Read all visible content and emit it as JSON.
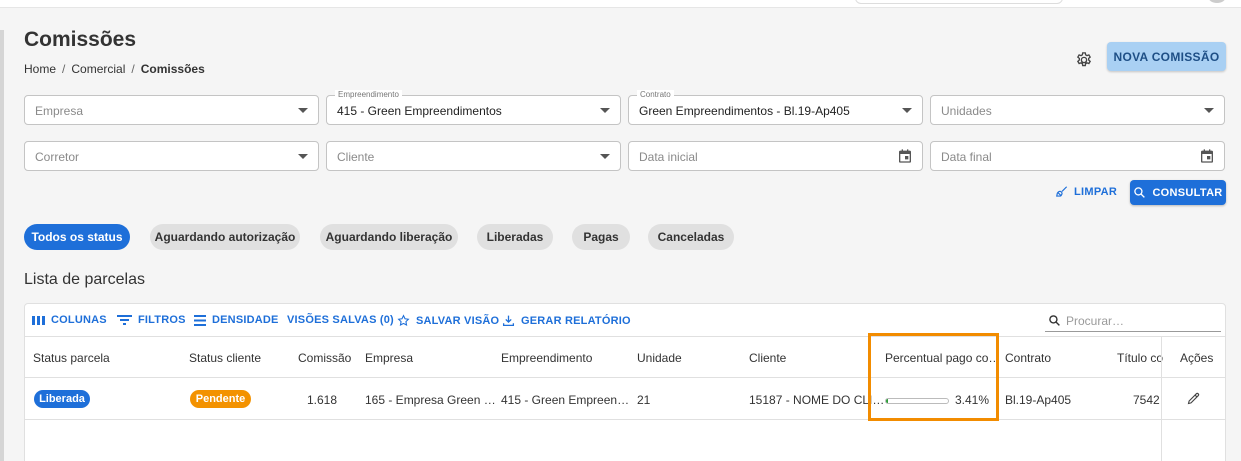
{
  "header": {
    "title": "Comissões",
    "breadcrumb": [
      "Home",
      "Comercial",
      "Comissões"
    ],
    "new_button": "NOVA COMISSÃO"
  },
  "filters": {
    "empresa": {
      "placeholder": "Empresa"
    },
    "empreendimento": {
      "label": "Empreendimento",
      "value": "415 - Green Empreendimentos"
    },
    "contrato": {
      "label": "Contrato",
      "value": "Green Empreendimentos - Bl.19-Ap405"
    },
    "unidades": {
      "placeholder": "Unidades"
    },
    "corretor": {
      "placeholder": "Corretor"
    },
    "cliente": {
      "placeholder": "Cliente"
    },
    "data_inicial": {
      "placeholder": "Data inicial"
    },
    "data_final": {
      "placeholder": "Data final"
    },
    "clear_label": "LIMPAR",
    "search_label": "CONSULTAR"
  },
  "status_chips": [
    "Todos os status",
    "Aguardando autorização",
    "Aguardando liberação",
    "Liberadas",
    "Pagas",
    "Canceladas"
  ],
  "list": {
    "title": "Lista de parcelas",
    "toolbar": {
      "columns": "COLUNAS",
      "filters": "FILTROS",
      "density": "DENSIDADE",
      "saved_views": "VISÕES SALVAS (0)",
      "save_view": "SALVAR VISÃO",
      "report": "GERAR RELATÓRIO",
      "search_placeholder": "Procurar…"
    },
    "columns": [
      "Status parcela",
      "Status cliente",
      "Comissão",
      "Empresa",
      "Empreendimento",
      "Unidade",
      "Cliente",
      "Percentual pago co…",
      "Contrato",
      "Título co",
      "Ações"
    ],
    "rows": [
      {
        "status_parcela": "Liberada",
        "status_cliente": "Pendente",
        "comissao": "1.618",
        "empresa": "165 - Empresa Green …",
        "empreendimento": "415 - Green Empreen…",
        "unidade": "21",
        "cliente": "15187 - NOME DO CLI…",
        "percentual_text": "3.41%",
        "percentual_value": 3.41,
        "contrato": "Bl.19-Ap405",
        "titulo": "7542"
      }
    ]
  },
  "colors": {
    "primary": "#1e6fd9",
    "liberada_badge": "#1e6fd9",
    "pendente_badge": "#f39200",
    "progress_fill": "#2e9e3a",
    "highlight_border": "#f28c00"
  }
}
